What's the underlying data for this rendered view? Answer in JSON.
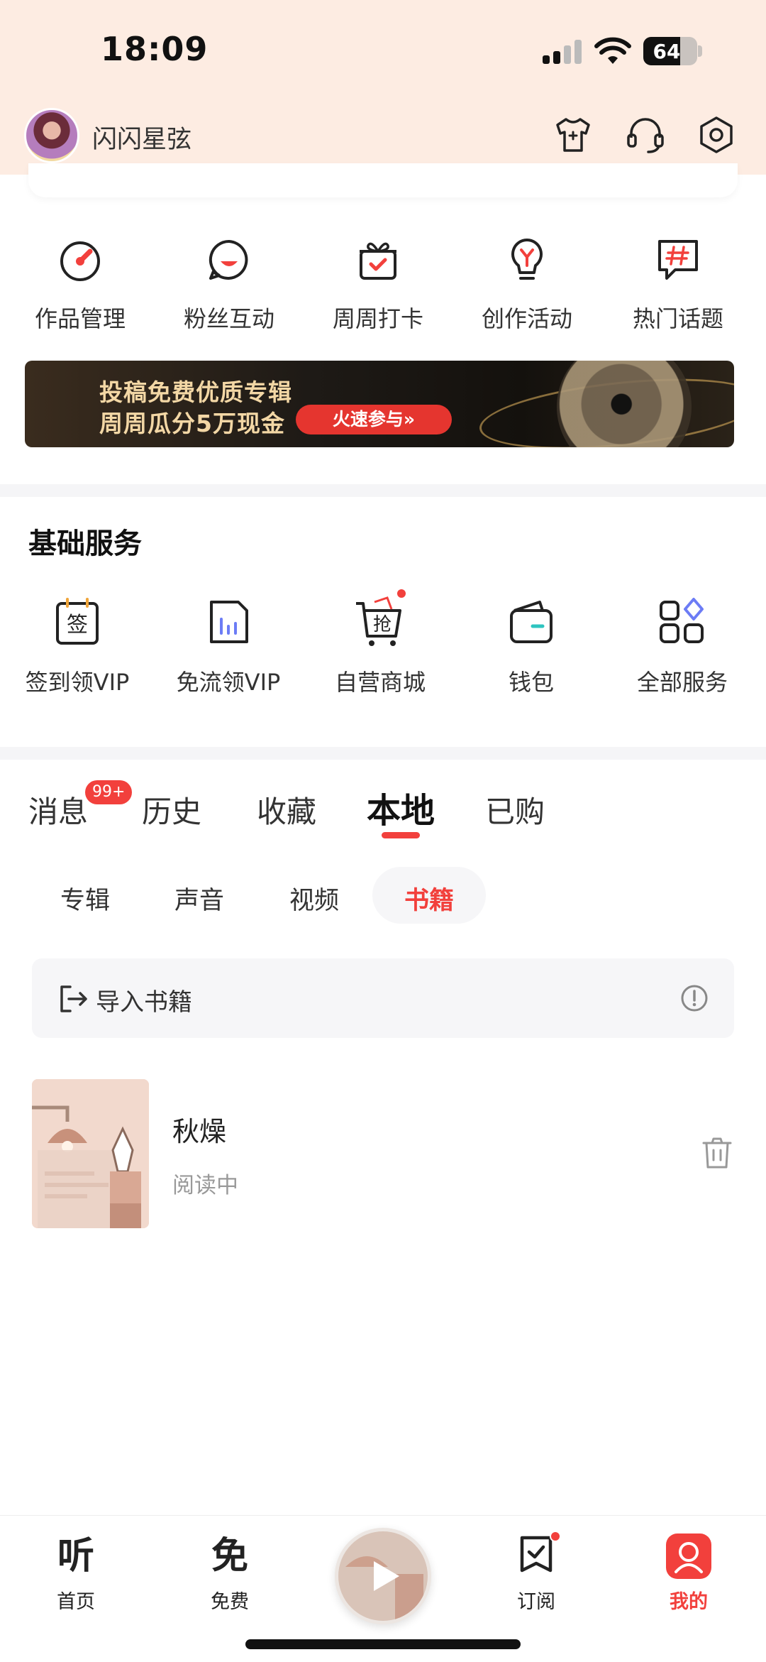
{
  "status_bar": {
    "time": "18:09",
    "battery": "64"
  },
  "header": {
    "username": "闪闪星弦",
    "icons": [
      "shirt-icon",
      "headset-icon",
      "settings-icon"
    ]
  },
  "quick_actions": [
    {
      "label": "作品管理",
      "icon": "gauge-icon"
    },
    {
      "label": "粉丝互动",
      "icon": "chat-smile-icon"
    },
    {
      "label": "周周打卡",
      "icon": "gift-check-icon"
    },
    {
      "label": "创作活动",
      "icon": "bulb-icon"
    },
    {
      "label": "热门话题",
      "icon": "hashtag-icon"
    }
  ],
  "banner": {
    "line1": "投稿免费优质专辑",
    "line2": "周周瓜分5万现金",
    "cta": "火速参与»"
  },
  "basic_services": {
    "title": "基础服务",
    "items": [
      {
        "label": "签到领VIP",
        "icon": "sign-in-icon",
        "glyph": "签"
      },
      {
        "label": "免流领VIP",
        "icon": "data-chart-icon"
      },
      {
        "label": "自营商城",
        "icon": "cart-icon",
        "glyph": "抢"
      },
      {
        "label": "钱包",
        "icon": "wallet-icon"
      },
      {
        "label": "全部服务",
        "icon": "grid-icon"
      }
    ]
  },
  "tabs": {
    "items": [
      "消息",
      "历史",
      "收藏",
      "本地",
      "已购"
    ],
    "active": "本地",
    "badge": "99+"
  },
  "subtabs": {
    "items": [
      "专辑",
      "声音",
      "视频",
      "书籍"
    ],
    "active": "书籍"
  },
  "import": {
    "label": "导入书籍"
  },
  "books": [
    {
      "title": "秋燥",
      "status": "阅读中"
    }
  ],
  "bottom_nav": [
    {
      "label": "首页",
      "glyph": "听"
    },
    {
      "label": "免费",
      "glyph": "免"
    },
    {
      "label": "订阅"
    },
    {
      "label": "我的"
    }
  ],
  "colors": {
    "accent": "#f2403c",
    "header_bg": "#fdece2",
    "section_gap": "#f5f5f7"
  }
}
